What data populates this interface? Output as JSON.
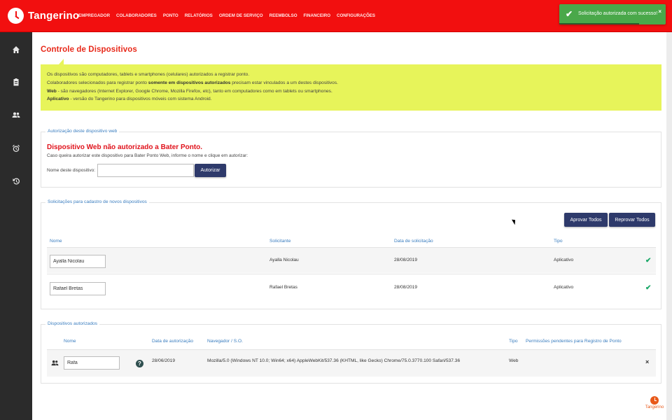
{
  "header": {
    "brand": "Tangerino",
    "nav": [
      "EMPREGADOR",
      "COLABORADORES",
      "PONTO",
      "RELATÓRIOS",
      "ORDEM DE SERVIÇO",
      "REEMBOLSO",
      "FINANCEIRO",
      "CONFIGURAÇÕES"
    ]
  },
  "toast": {
    "message": "Solicitação autorizada com sucesso!",
    "close": "×"
  },
  "sidebar": {
    "icons": [
      "home-icon",
      "clipboard-icon",
      "users-icon",
      "alarm-clock-icon",
      "history-icon"
    ]
  },
  "page": {
    "title": "Controle de Dispositivos"
  },
  "info": {
    "line1": "Os dispositivos são computadores, tablets e smartphones (celulares) autorizados a registrar ponto.",
    "line2_pre": "Colaboradores selecionados para registrar ponto ",
    "line2_bold": "somente em dispositivos autorizados",
    "line2_post": " precisam estar vinculados a um destes dispositivos.",
    "line3_bold": "Web",
    "line3_post": " - são navegadores (Internet Explorer, Google Chrome, Mozilla Firefox, etc), tanto em computadores como em tablets ou smartphones.",
    "line4_bold": "Aplicativo",
    "line4_post": " - versão do Tangerino para dispositivos móveis com sistema Android."
  },
  "auth_panel": {
    "legend": "Autorização deste dispositivo web",
    "warning": "Dispositivo Web não autorizado a Bater Ponto.",
    "subtitle": "Caso queira autorizar este dispositivo para Bater Ponto Web, informe o nome e clique em autorizar:",
    "name_label": "Nome deste dispositivo:",
    "name_value": "",
    "authorize_button": "Autorizar"
  },
  "requests_panel": {
    "legend": "Solicitações para cadastro de novos dispositivos",
    "approve_all": "Aprovar Todos",
    "reject_all": "Reprovar Todos",
    "columns": [
      "Nome",
      "Solicitante",
      "Data de solicitação",
      "Tipo"
    ],
    "rows": [
      {
        "name": "Ayalla Nicolau",
        "requester": "Ayalla Nicolau",
        "date": "28/08/2019",
        "type": "Aplicativo"
      },
      {
        "name": "Rafael Bretas",
        "requester": "Rafael Bretas",
        "date": "28/08/2019",
        "type": "Aplicativo"
      }
    ]
  },
  "authorized_panel": {
    "legend": "Dispositivos autorizados",
    "columns": [
      "Nome",
      "Data de autorização",
      "Navegador / S.O.",
      "Tipo",
      "Permissões pendentes para Registro de Ponto"
    ],
    "rows": [
      {
        "name": "Rafa",
        "help": "?",
        "date": "28/06/2019",
        "browser": "Mozilla/5.0 (Windows NT 10.0; Win64; x64) AppleWebKit/537.36 (KHTML, like Gecko) Chrome/75.0.3770.100 Safari/537.36",
        "type": "Web",
        "remove": "×"
      }
    ]
  },
  "footer": {
    "brand": "Tangerino"
  }
}
